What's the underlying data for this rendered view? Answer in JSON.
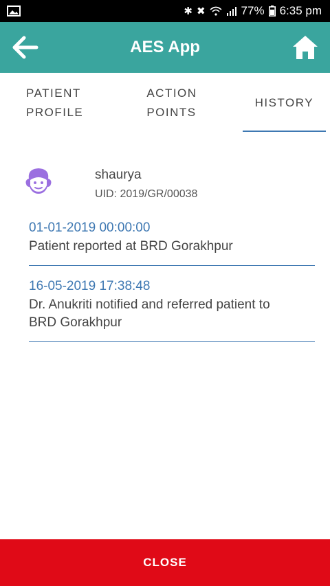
{
  "status": {
    "battery": "77%",
    "time": "6:35 pm",
    "icons": [
      "image-icon",
      "bluetooth-icon",
      "mute-icon",
      "wifi-icon",
      "signal-icon",
      "battery-icon"
    ]
  },
  "app": {
    "title": "AES App",
    "back_icon": "arrow-left-icon",
    "home_icon": "home-icon",
    "bar_color": "#3aa59e"
  },
  "tabs": [
    {
      "line1": "PATIENT",
      "line2": "PROFILE"
    },
    {
      "line1": "ACTION",
      "line2": "POINTS"
    },
    {
      "line1": "HISTORY",
      "line2": ""
    }
  ],
  "patient": {
    "name": "shaurya",
    "uid": "UID: 2019/GR/00038",
    "avatar_icon": "child-face-icon"
  },
  "history": [
    {
      "time": "01-01-2019 00:00:00",
      "text": "Patient reported at BRD Gorakhpur"
    },
    {
      "time": "16-05-2019 17:38:48",
      "text": "Dr. Anukriti notified and referred patient to BRD Gorakhpur"
    }
  ],
  "footer": {
    "close_label": "CLOSE",
    "color": "#e00a17"
  }
}
